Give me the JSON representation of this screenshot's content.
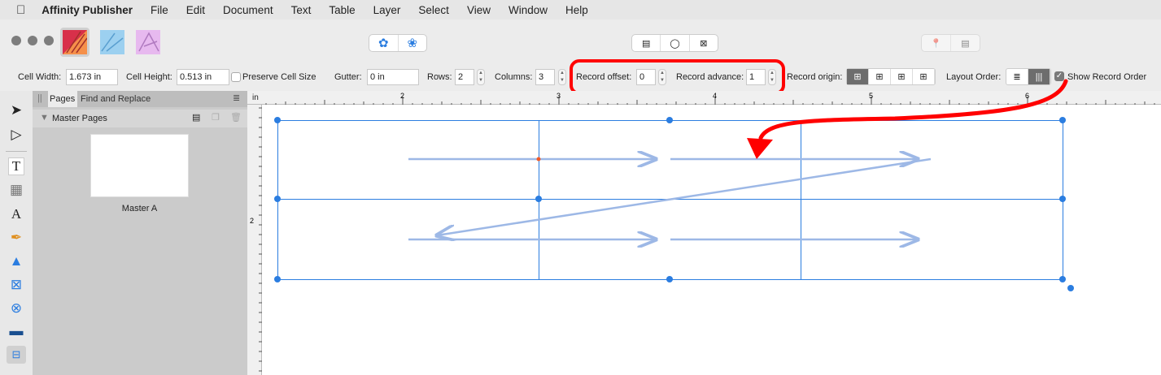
{
  "menubar": {
    "apple": "",
    "app": "Affinity Publisher",
    "items": [
      "File",
      "Edit",
      "Document",
      "Text",
      "Table",
      "Layer",
      "Select",
      "View",
      "Window",
      "Help"
    ]
  },
  "context": {
    "cell_width_label": "Cell Width:",
    "cell_width": "1.673 in",
    "cell_height_label": "Cell Height:",
    "cell_height": "0.513 in",
    "preserve_label": "Preserve Cell Size",
    "preserve_checked": false,
    "gutter_label": "Gutter:",
    "gutter": "0 in",
    "rows_label": "Rows:",
    "rows": "2",
    "columns_label": "Columns:",
    "columns": "3",
    "record_offset_label": "Record offset:",
    "record_offset": "0",
    "record_advance_label": "Record advance:",
    "record_advance": "1",
    "record_origin_label": "Record origin:",
    "layout_order_label": "Layout Order:",
    "show_record_order_label": "Show Record Order",
    "show_record_order_checked": true
  },
  "panel": {
    "tabs": [
      "Pages",
      "Find and Replace"
    ],
    "section": "Master Pages",
    "page_label": "Master A"
  },
  "ruler": {
    "unit": "in",
    "h_labels": [
      "2",
      "3",
      "4",
      "5",
      "6"
    ],
    "v_labels": [
      "2"
    ]
  },
  "annotation_color": "#ff0000",
  "accent": "#2b7de0"
}
